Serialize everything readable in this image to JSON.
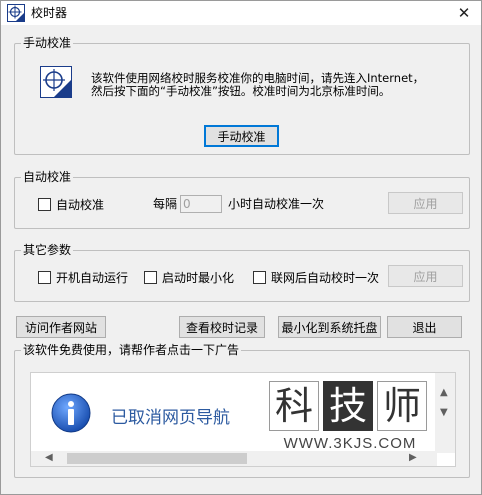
{
  "window": {
    "title": "校时器",
    "close_glyph": "✕"
  },
  "manual": {
    "group_label": "手动校准",
    "description_line1": "该软件使用网络校时服务校准你的电脑时间，请先连入Internet，",
    "description_line2": "然后按下面的“手动校准”按钮。校准时间为北京标准时间。",
    "button_label": "手动校准"
  },
  "auto": {
    "group_label": "自动校准",
    "checkbox_label": "自动校准",
    "interval_label": "每隔",
    "interval_value": "0",
    "interval_suffix": "小时自动校准一次",
    "apply_label": "应用"
  },
  "other": {
    "group_label": "其它参数",
    "opt_startup": "开机自动运行",
    "opt_minimize": "启动时最小化",
    "opt_network": "联网后自动校时一次",
    "apply_label": "应用"
  },
  "actions": {
    "visit_site": "访问作者网站",
    "view_log": "查看校时记录",
    "minimize_tray": "最小化到系统托盘",
    "exit": "退出"
  },
  "ad": {
    "group_label": "该软件免费使用，请帮作者点击一下广告",
    "message": "已取消网页导航"
  },
  "watermark": {
    "chars": [
      "科",
      "技",
      "师"
    ],
    "url": "WWW.3KJS.COM"
  },
  "icons": [
    "app-clock-icon",
    "close-icon",
    "clock-icon",
    "info-icon",
    "scroll-up-icon",
    "scroll-down-icon",
    "scroll-left-icon",
    "scroll-right-icon"
  ],
  "colors": {
    "default_button_border": "#0078d7",
    "ad_text": "#2c5aa0",
    "window_bg": "#f0f0f0"
  }
}
